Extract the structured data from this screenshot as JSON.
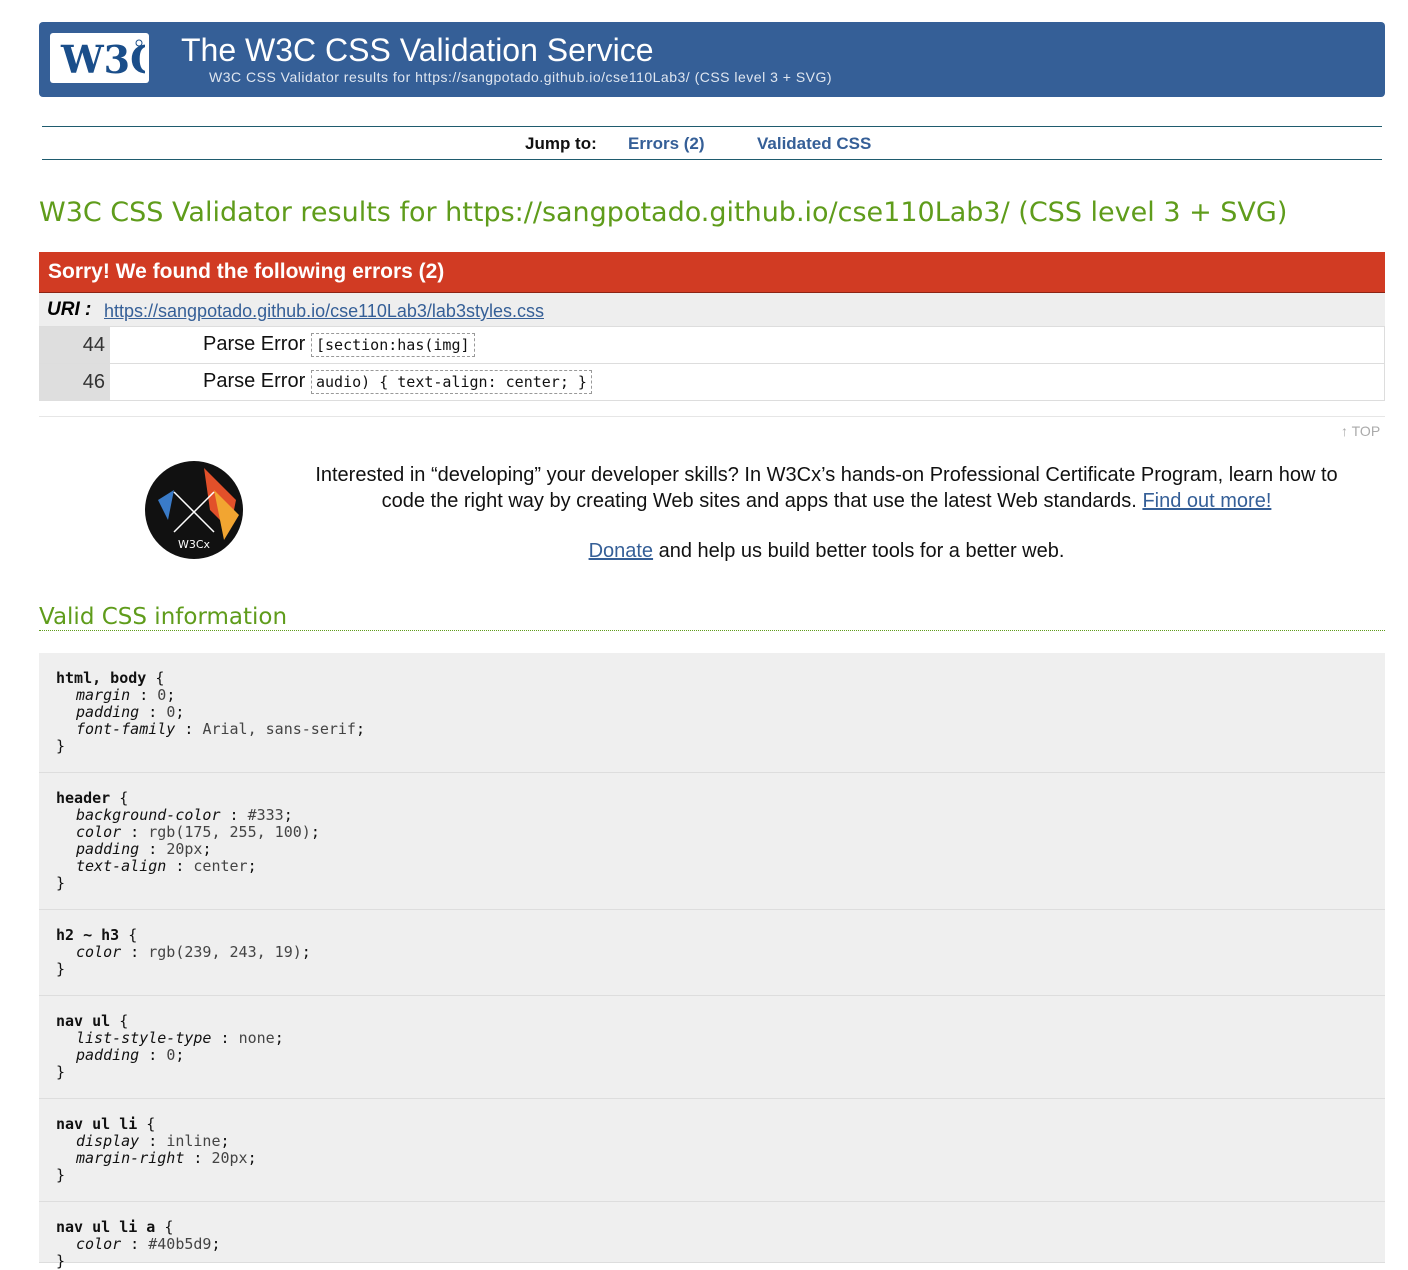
{
  "header": {
    "logo_text": "W3C",
    "title": "The W3C CSS Validation Service",
    "subtitle": "W3C CSS Validator results for https://sangpotado.github.io/cse110Lab3/ (CSS level 3 + SVG)"
  },
  "jump": {
    "label": "Jump to:",
    "errors_link": "Errors (2)",
    "validated_link": "Validated CSS"
  },
  "results_title": "W3C CSS Validator results for https://sangpotado.github.io/cse110Lab3/ (CSS level 3 + SVG)",
  "errors": {
    "heading": "Sorry! We found the following errors (2)",
    "uri_label": "URI :",
    "uri": "https://sangpotado.github.io/cse110Lab3/lab3styles.css",
    "rows": [
      {
        "line": "44",
        "type": "Parse Error",
        "code": "[section:has(img]"
      },
      {
        "line": "46",
        "type": "Parse Error",
        "code": "audio) { text-align: center; }"
      }
    ]
  },
  "top_link": "↑ TOP",
  "promo": {
    "logo_text": "W3Cx",
    "text": "Interested in “developing” your developer skills? In W3Cx’s hands-on Professional Certificate Program, learn how to code the right way by creating Web sites and apps that use the latest Web standards.",
    "link": "Find out more!",
    "donate_link": "Donate",
    "donate_text": " and help us build better tools for a better web."
  },
  "valid_title": "Valid CSS information",
  "css_rules": [
    {
      "selector": "html, body",
      "decls": [
        {
          "prop": "margin",
          "val": "0"
        },
        {
          "prop": "padding",
          "val": "0"
        },
        {
          "prop": "font-family",
          "val": "Arial, sans-serif"
        }
      ]
    },
    {
      "selector": "header",
      "decls": [
        {
          "prop": "background-color",
          "val": "#333"
        },
        {
          "prop": "color",
          "val": "rgb(175, 255, 100)"
        },
        {
          "prop": "padding",
          "val": "20px"
        },
        {
          "prop": "text-align",
          "val": "center"
        }
      ]
    },
    {
      "selector": "h2 ~ h3",
      "decls": [
        {
          "prop": "color",
          "val": "rgb(239, 243, 19)"
        }
      ]
    },
    {
      "selector": "nav ul",
      "decls": [
        {
          "prop": "list-style-type",
          "val": "none"
        },
        {
          "prop": "padding",
          "val": "0"
        }
      ]
    },
    {
      "selector": "nav ul li",
      "decls": [
        {
          "prop": "display",
          "val": "inline"
        },
        {
          "prop": "margin-right",
          "val": "20px"
        }
      ]
    },
    {
      "selector": "nav ul li a",
      "decls": [
        {
          "prop": "color",
          "val": "#40b5d9"
        }
      ]
    }
  ]
}
